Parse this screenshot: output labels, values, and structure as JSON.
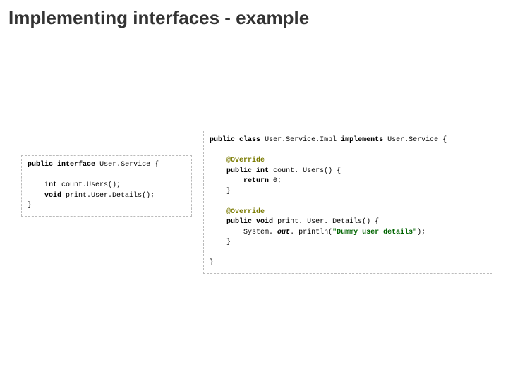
{
  "title": "Implementing interfaces - example",
  "kw": {
    "public": "public",
    "interface": "interface",
    "class": "class",
    "implements": "implements",
    "int": "int",
    "void": "void",
    "return": "return"
  },
  "ann": "@Override",
  "iface": {
    "name": "User.Service",
    "m1": "count.Users();",
    "m2": "print.User.Details();"
  },
  "impl": {
    "name": "User.Service.Impl",
    "m1_sig": "count. Users() {",
    "m1_ret_val": "0",
    "m2_sig": "print. User. Details() {",
    "sys": "System.",
    "out": "out",
    "println_open": ". println(",
    "str": "\"Dummy user details\"",
    "println_close": ");"
  },
  "brace_open": "{",
  "brace_close": "}",
  "semicolon": ";"
}
